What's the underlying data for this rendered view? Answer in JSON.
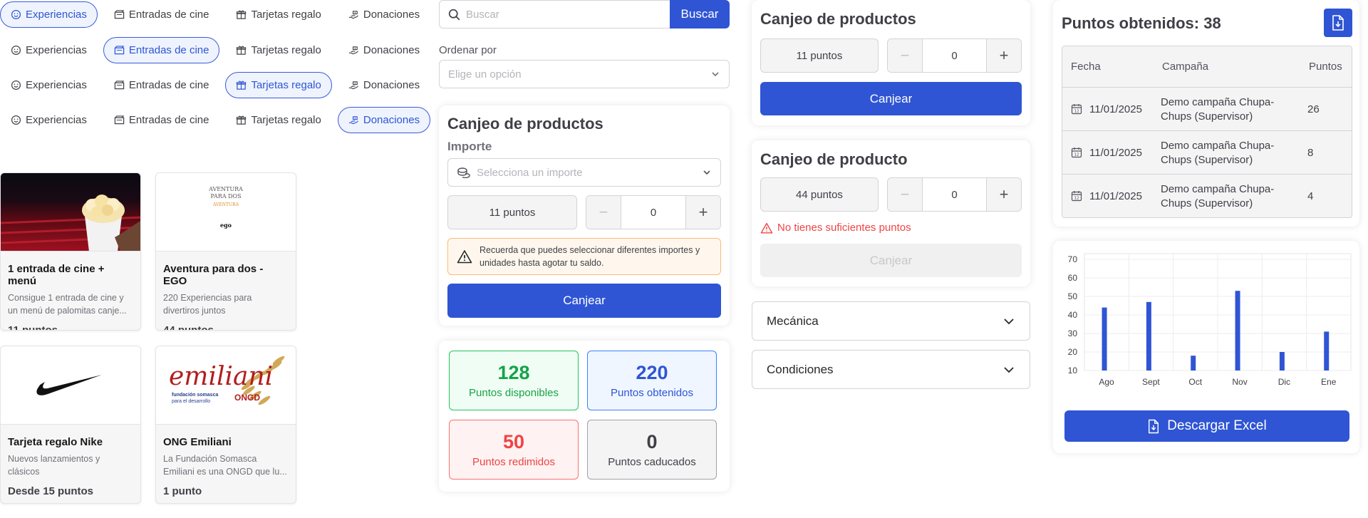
{
  "tab_rows": [
    {
      "active": 0,
      "labels": [
        "Experiencias",
        "Entradas de cine",
        "Tarjetas regalo",
        "Donaciones"
      ]
    },
    {
      "active": 1,
      "labels": [
        "Experiencias",
        "Entradas de cine",
        "Tarjetas regalo",
        "Donaciones"
      ]
    },
    {
      "active": 2,
      "labels": [
        "Experiencias",
        "Entradas de cine",
        "Tarjetas regalo",
        "Donaciones"
      ]
    },
    {
      "active": 3,
      "labels": [
        "Experiencias",
        "Entradas de cine",
        "Tarjetas regalo",
        "Donaciones"
      ]
    }
  ],
  "products": [
    {
      "title": "1 entrada de cine + menú",
      "desc": "Consigue 1 entrada de cine y un menú de palomitas canje...",
      "points": "11 puntos",
      "image": "cinema-popcorn-image"
    },
    {
      "title": "Aventura para dos - EGO",
      "desc": "220 Experiencias para divertiros juntos",
      "points": "44 puntos",
      "image": "ego-aventura-logo",
      "logo": {
        "line1": "AVENTURA",
        "line2": "PARA DOS",
        "line3": "AVENTURA",
        "brand": "ego"
      }
    },
    {
      "title": "Tarjeta regalo Nike",
      "desc": "Nuevos lanzamientos y clásicos",
      "points": "Desde 15 puntos",
      "image": "nike-swoosh-logo"
    },
    {
      "title": "ONG Emiliani",
      "desc": "La Fundación Somasca Emiliani es una ONGD que lu...",
      "points": "1 punto",
      "image": "emiliani-logo",
      "logo": {
        "word": "emiliani",
        "sub1": "fundación somasca",
        "sub2": "para el desarrollo",
        "ongd": "ONGD"
      }
    }
  ],
  "search": {
    "placeholder": "Buscar",
    "button": "Buscar"
  },
  "sort": {
    "label": "Ordenar por",
    "placeholder": "Elige un opción"
  },
  "redeem1": {
    "title": "Canjeo de productos",
    "amount_label": "Importe",
    "amount_placeholder": "Selecciona un importe",
    "points": "11 puntos",
    "qty": "0",
    "warning": "Recuerda que puedes seleccionar diferentes importes y unidades hasta agotar tu saldo.",
    "button": "Canjear"
  },
  "stats": [
    {
      "value": "128",
      "label": "Puntos disponibles",
      "color": "#16a34a",
      "bg": "#f0fdf4",
      "border": "#22c55e"
    },
    {
      "value": "220",
      "label": "Puntos obtenidos",
      "color": "#2f55d4",
      "bg": "#eff6ff",
      "border": "#3b82f6"
    },
    {
      "value": "50",
      "label": "Puntos redimidos",
      "color": "#ef4444",
      "bg": "#fef2f2",
      "border": "#f87171"
    },
    {
      "value": "0",
      "label": "Puntos caducados",
      "color": "#3f3f46",
      "bg": "#f4f4f5",
      "border": "#a1a1aa"
    }
  ],
  "redeem2": {
    "title": "Canjeo de productos",
    "points": "11 puntos",
    "qty": "0",
    "button": "Canjear"
  },
  "redeem3": {
    "title": "Canjeo de producto",
    "points": "44 puntos",
    "qty": "0",
    "error": "No tienes suficientes puntos",
    "button": "Canjear"
  },
  "accordions": [
    "Mecánica",
    "Condiciones"
  ],
  "earned": {
    "title": "Puntos obtenidos: 38",
    "headers": [
      "Fecha",
      "Campaña",
      "Puntos"
    ],
    "rows": [
      {
        "date": "11/01/2025",
        "campaign": "Demo campaña Chupa-Chups (Supervisor)",
        "points": "26"
      },
      {
        "date": "11/01/2025",
        "campaign": "Demo campaña Chupa-Chups (Supervisor)",
        "points": "8"
      },
      {
        "date": "11/01/2025",
        "campaign": "Demo campaña Chupa-Chups (Supervisor)",
        "points": "4"
      }
    ]
  },
  "chart_data": {
    "type": "bar",
    "categories": [
      "Ago",
      "Sept",
      "Oct",
      "Nov",
      "Dic",
      "Ene"
    ],
    "values": [
      44,
      47,
      18,
      53,
      20,
      31
    ],
    "yticks": [
      10,
      20,
      30,
      40,
      50,
      60,
      70
    ],
    "ylim": [
      10,
      70
    ],
    "grid": true,
    "color": "#2f55d4"
  },
  "download": {
    "label": "Descargar Excel"
  },
  "colors": {
    "primary": "#2f55d4",
    "error": "#ef4444"
  }
}
